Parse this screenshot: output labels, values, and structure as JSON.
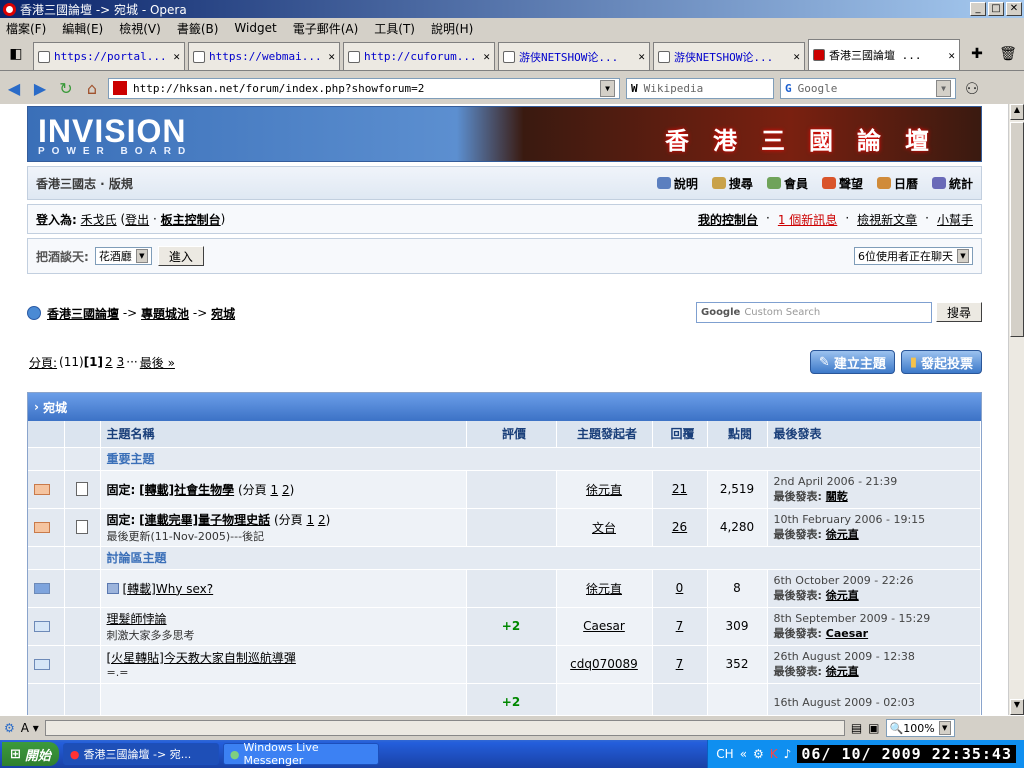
{
  "window": {
    "title": "香港三國論壇 -> 宛城 - Opera"
  },
  "menu": [
    "檔案(F)",
    "編輯(E)",
    "檢視(V)",
    "書籤(B)",
    "Widget",
    "電子郵件(A)",
    "工具(T)",
    "說明(H)"
  ],
  "tabs": [
    {
      "label": "https://portal...",
      "active": false
    },
    {
      "label": "https://webmai...",
      "active": false
    },
    {
      "label": "http://cuforum...",
      "active": false
    },
    {
      "label": "游侠NETSHOW论...",
      "active": false
    },
    {
      "label": "游侠NETSHOW论...",
      "active": false
    },
    {
      "label": "香港三國論壇 ...",
      "active": true
    }
  ],
  "address": {
    "url": "http://hksan.net/forum/index.php?showforum=2",
    "wiki_placeholder": "Wikipedia",
    "google_placeholder": "Google"
  },
  "banner": {
    "logo": "INVISION",
    "logo_sub": "POWER BOARD",
    "cn_title": "香港三國論壇"
  },
  "forumnav": {
    "title": "香港三國志 · 版規",
    "links": [
      {
        "label": "說明",
        "color": "#5b7fbf"
      },
      {
        "label": "搜尋",
        "color": "#c9a24a"
      },
      {
        "label": "會員",
        "color": "#6fa35a"
      },
      {
        "label": "聲望",
        "color": "#d9542b"
      },
      {
        "label": "日曆",
        "color": "#d08b3a"
      },
      {
        "label": "統計",
        "color": "#6a6ab8"
      }
    ]
  },
  "userbar": {
    "logged_as": "登入為:",
    "username": "禾戈氏",
    "logout": "登出",
    "modcp": "板主控制台",
    "mycp": "我的控制台",
    "new_msg": "1 個新訊息",
    "new_posts": "檢視新文章",
    "helper": "小幫手"
  },
  "chat": {
    "label": "把酒談天:",
    "room": "花酒廳",
    "enter": "進入",
    "users": "6位使用者正在聊天"
  },
  "breadcrumb": [
    "香港三國論壇",
    "專題城池",
    "宛城"
  ],
  "search": {
    "placeholder": "Custom Search",
    "button": "搜尋"
  },
  "pager": {
    "label": "分頁:",
    "total": "(11)",
    "current": "[1]",
    "pages": [
      "2",
      "3"
    ],
    "last": "最後 »"
  },
  "actions": {
    "new_topic": "建立主題",
    "new_poll": "發起投票"
  },
  "table": {
    "forum_name": "宛城",
    "columns": [
      "主題名稱",
      "評價",
      "主題發起者",
      "回覆",
      "點閱",
      "最後發表"
    ],
    "sections": [
      {
        "title": "重要主題",
        "rows": [
          {
            "prefix": "固定:",
            "title": "[轉載]社會生物學",
            "pages_label": "(分頁",
            "pages": [
              "1",
              "2"
            ],
            "sub": "",
            "rating": "",
            "starter": "徐元直",
            "replies": "21",
            "views": "2,519",
            "last_date": "2nd April 2006 - 21:39",
            "last_label": "最後發表:",
            "last_user": "關乾",
            "icon": "hot"
          },
          {
            "prefix": "固定:",
            "title": "[連載完畢]量子物理史話",
            "pages_label": "(分頁",
            "pages": [
              "1",
              "2"
            ],
            "sub": "最後更新(11-Nov-2005)---後記",
            "rating": "",
            "starter": "文台",
            "replies": "26",
            "views": "4,280",
            "last_date": "10th February 2006 - 19:15",
            "last_label": "最後發表:",
            "last_user": "徐元直",
            "icon": "hot"
          }
        ]
      },
      {
        "title": "討論區主題",
        "rows": [
          {
            "prefix": "",
            "title": "[轉載]Why sex?",
            "pages_label": "",
            "pages": [],
            "sub": "",
            "rating": "",
            "starter": "徐元直",
            "replies": "0",
            "views": "8",
            "last_date": "6th October 2009 - 22:26",
            "last_label": "最後發表:",
            "last_user": "徐元直",
            "icon": "new"
          },
          {
            "prefix": "",
            "title": "理髮師悖論",
            "pages_label": "",
            "pages": [],
            "sub": "刺激大家多多思考",
            "rating": "+2",
            "starter": "Caesar",
            "replies": "7",
            "views": "309",
            "last_date": "8th September 2009 - 15:29",
            "last_label": "最後發表:",
            "last_user": "Caesar",
            "icon": "old"
          },
          {
            "prefix": "",
            "title": "[火星轉貼]今天教大家自制巡航導彈",
            "pages_label": "",
            "pages": [],
            "sub": "=.=",
            "rating": "",
            "starter": "cdq070089",
            "replies": "7",
            "views": "352",
            "last_date": "26th August 2009 - 12:38",
            "last_label": "最後發表:",
            "last_user": "徐元直",
            "icon": "old"
          }
        ]
      }
    ],
    "partial_row": {
      "rating": "+2",
      "last_date": "16th August 2009 - 02:03"
    }
  },
  "statusbar": {
    "zoom": "100%"
  },
  "taskbar": {
    "start": "開始",
    "tasks": [
      {
        "label": "香港三國論壇 -> 宛...",
        "active": true
      },
      {
        "label": "Windows Live Messenger",
        "active": false
      }
    ],
    "clock": "06/ 10/ 2009 22:35:43"
  }
}
